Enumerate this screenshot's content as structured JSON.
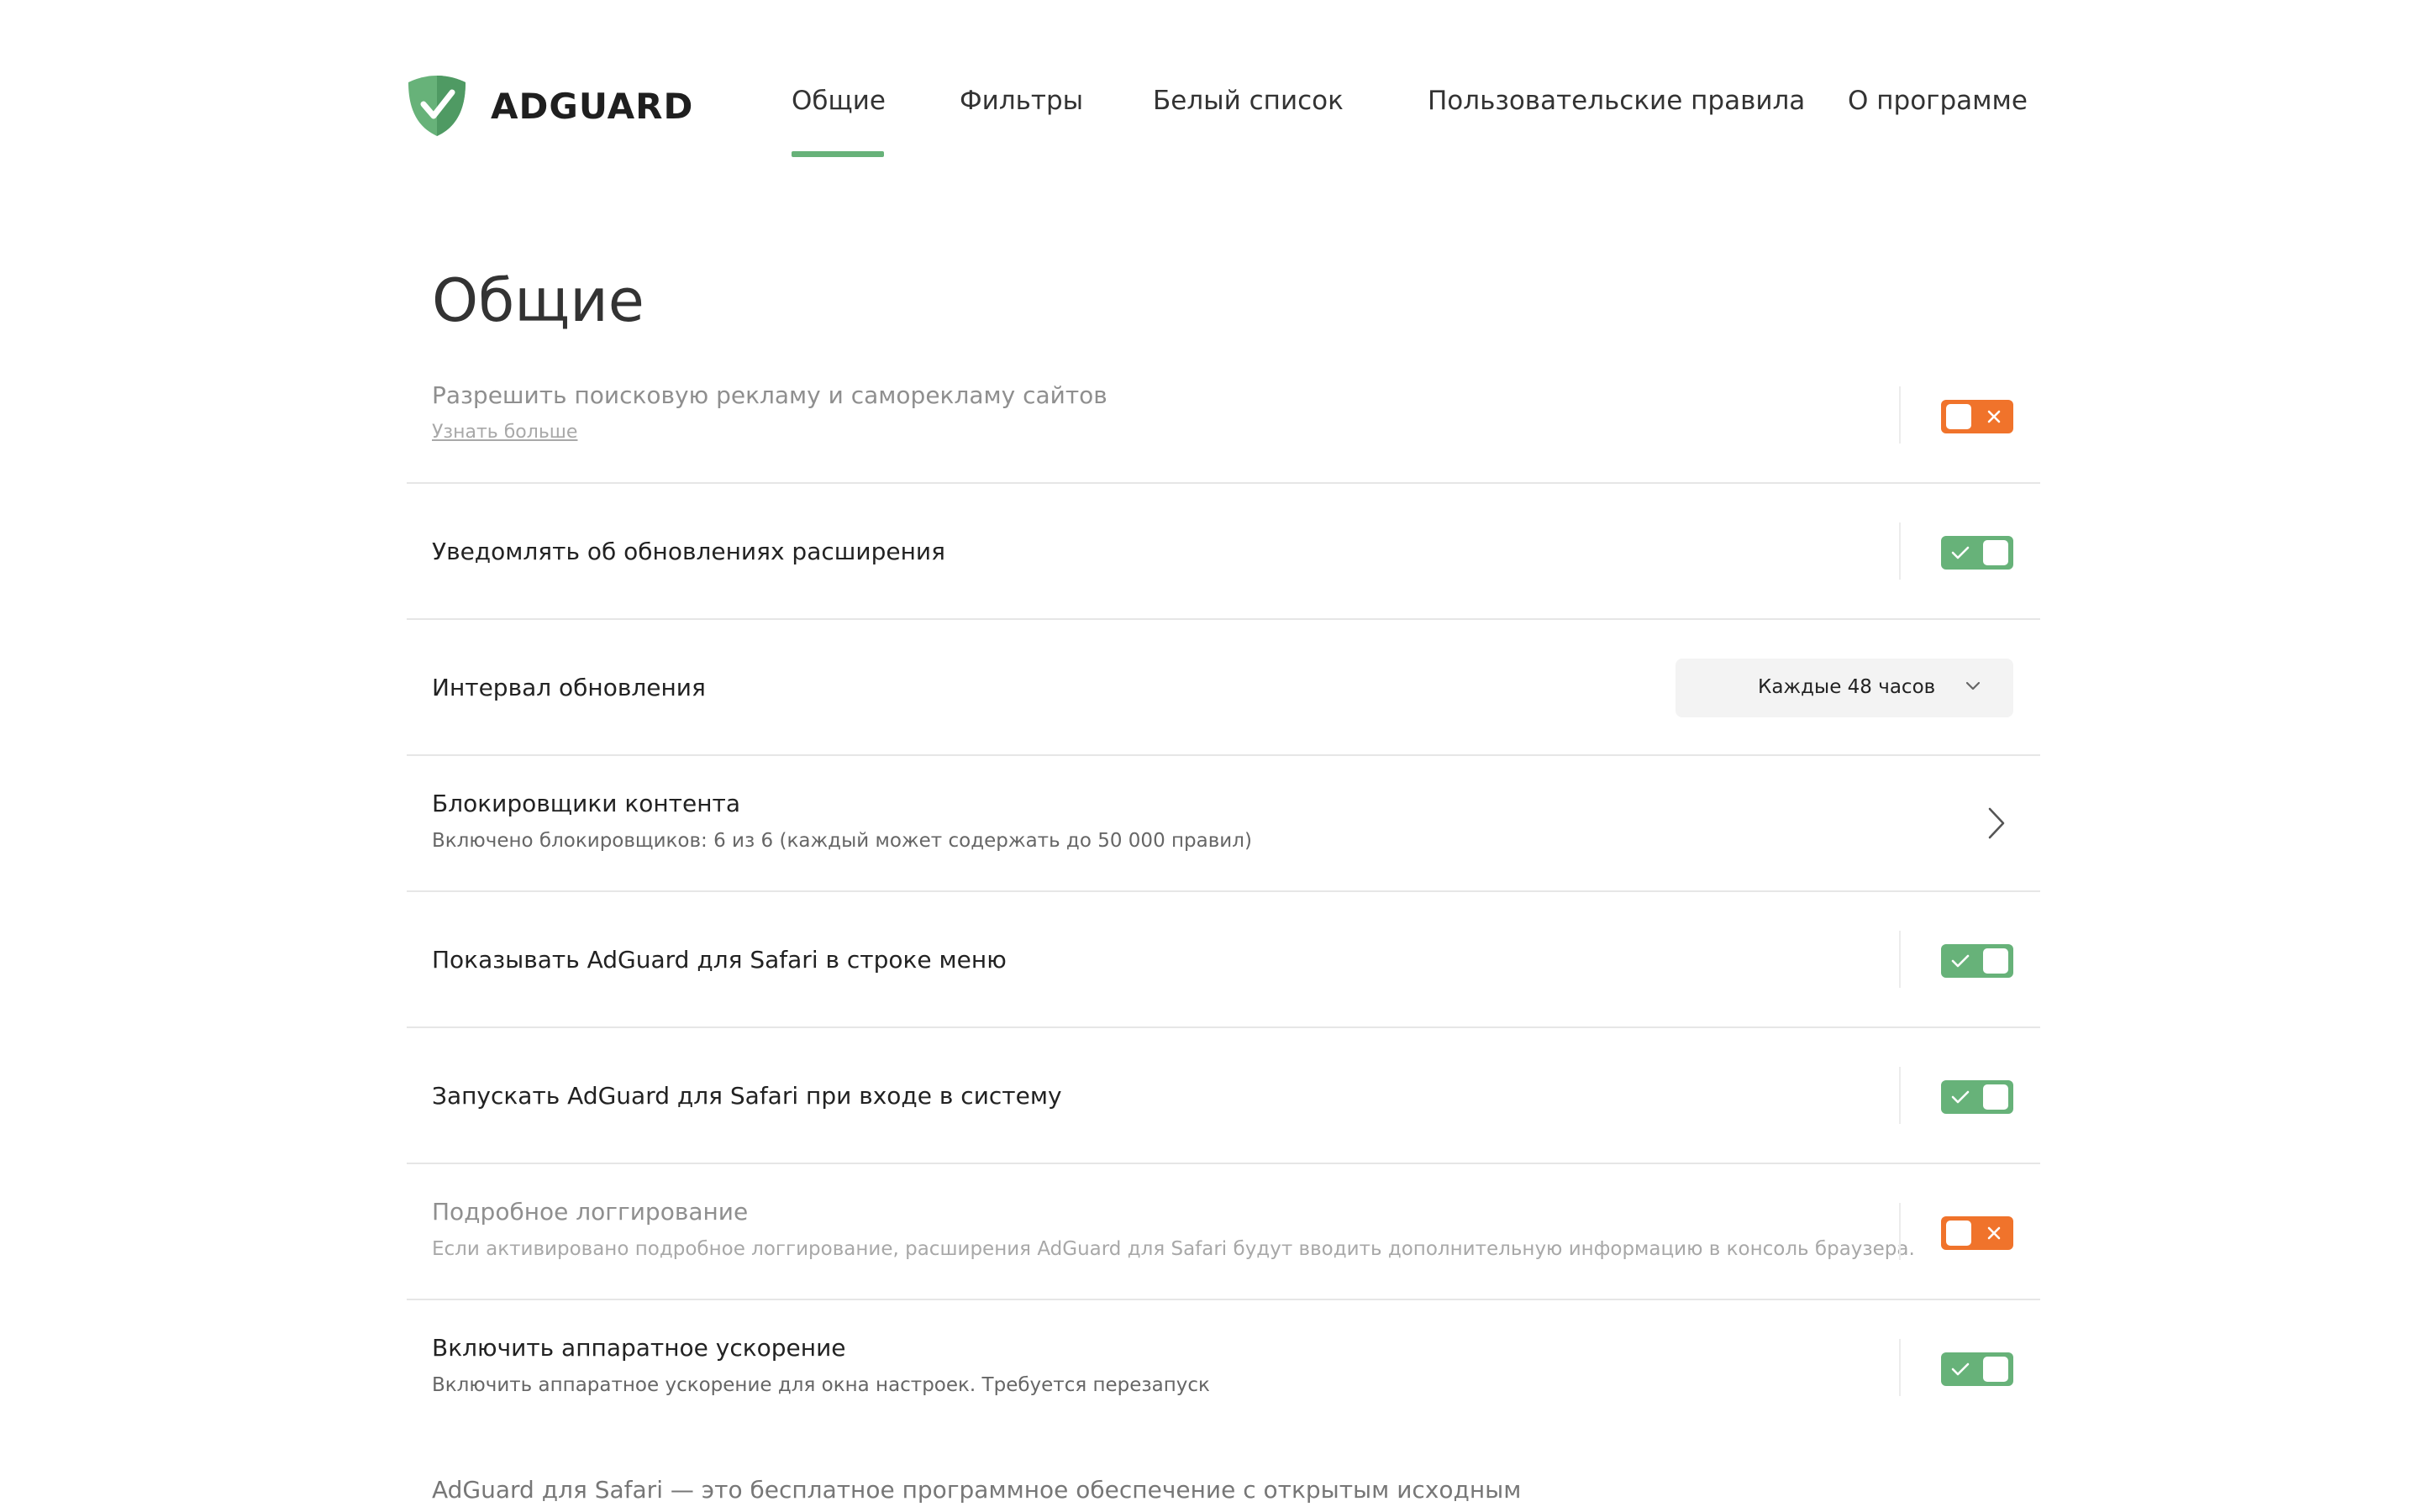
{
  "app": {
    "brand": "ADGUARD",
    "logo_icon": "adguard-shield-icon",
    "accent_color": "#67b279",
    "off_color": "#f0732b"
  },
  "nav": {
    "tabs": [
      {
        "label": "Общие",
        "active": true
      },
      {
        "label": "Фильтры",
        "active": false
      },
      {
        "label": "Белый список",
        "active": false
      },
      {
        "label": "Пользовательские правила",
        "active": false
      },
      {
        "label": "О программе",
        "active": false
      }
    ]
  },
  "page": {
    "title": "Общие"
  },
  "settings": {
    "search_ads": {
      "title": "Разрешить поисковую рекламу и саморекламу сайтов",
      "link": "Узнать больше",
      "enabled": false
    },
    "notify_updates": {
      "title": "Уведомлять об обновлениях расширения",
      "enabled": true
    },
    "update_interval": {
      "title": "Интервал обновления",
      "selected": "Каждые 48 часов",
      "icon": "chevron-down-icon"
    },
    "content_blockers": {
      "title": "Блокировщики контента",
      "subtitle": "Включено блокировщиков: 6 из 6 (каждый может содержать до 50 000 правил)",
      "icon": "chevron-right-icon"
    },
    "show_in_menubar": {
      "title": "Показывать AdGuard для Safari в строке меню",
      "enabled": true
    },
    "launch_at_login": {
      "title": "Запускать AdGuard для Safari при входе в систему",
      "enabled": true
    },
    "verbose_logging": {
      "title": "Подробное логгирование",
      "subtitle": "Если активировано подробное логгирование, расширения AdGuard для Safari будут вводить дополнительную информацию в консоль браузера.",
      "enabled": false
    },
    "hardware_acceleration": {
      "title": "Включить аппаратное ускорение",
      "subtitle": "Включить аппаратное ускорение для окна настроек. Требуется перезапуск",
      "enabled": true
    }
  },
  "footer": {
    "text": "AdGuard для Safari — это бесплатное программное обеспечение с открытым исходным кодом. Мы приветствуем ваши отзывы и предложения. Если вы хотите сообщить об ошибке"
  }
}
